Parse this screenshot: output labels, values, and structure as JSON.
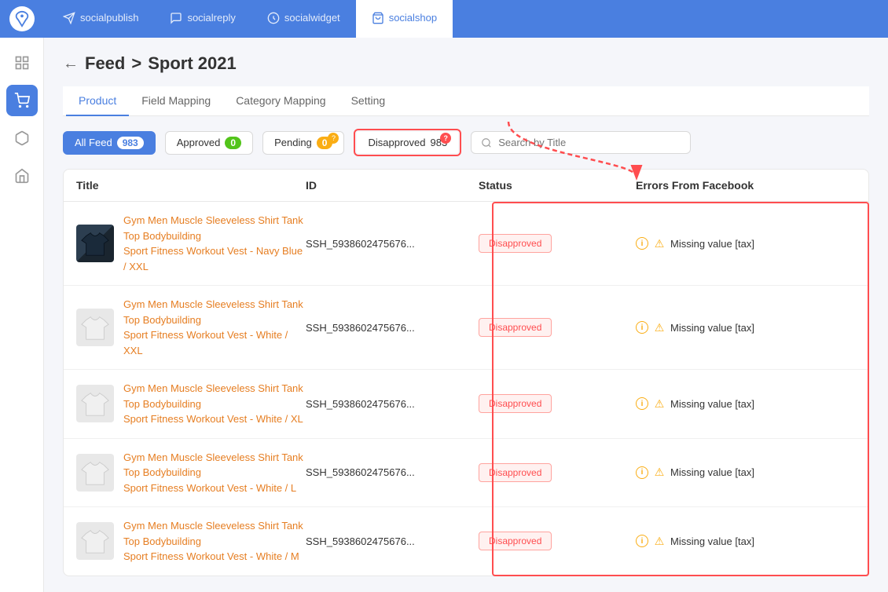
{
  "app": {
    "logo_alt": "Deer logo"
  },
  "nav": {
    "tabs": [
      {
        "id": "socialpublish",
        "label": "socialpublish",
        "active": false
      },
      {
        "id": "socialreply",
        "label": "socialreply",
        "active": false
      },
      {
        "id": "socialwidget",
        "label": "socialwidget",
        "active": false
      },
      {
        "id": "socialshop",
        "label": "socialshop",
        "active": true
      }
    ]
  },
  "sidebar": {
    "items": [
      {
        "id": "dashboard",
        "icon": "grid",
        "active": false
      },
      {
        "id": "socialshop",
        "icon": "shop",
        "active": true
      },
      {
        "id": "box",
        "icon": "box",
        "active": false
      },
      {
        "id": "store",
        "icon": "store",
        "active": false
      }
    ]
  },
  "breadcrumb": {
    "back_label": "Feed",
    "current": "Sport 2021",
    "separator": ">"
  },
  "page_tabs": [
    {
      "id": "product",
      "label": "Product",
      "active": true
    },
    {
      "id": "field-mapping",
      "label": "Field Mapping",
      "active": false
    },
    {
      "id": "category-mapping",
      "label": "Category Mapping",
      "active": false
    },
    {
      "id": "setting",
      "label": "Setting",
      "active": false
    }
  ],
  "filter_buttons": [
    {
      "id": "all-feed",
      "label": "All Feed",
      "count": "983",
      "type": "primary"
    },
    {
      "id": "approved",
      "label": "Approved",
      "count": "0",
      "type": "green"
    },
    {
      "id": "pending",
      "label": "Pending",
      "count": "0",
      "type": "yellow"
    },
    {
      "id": "disapproved",
      "label": "Disapproved",
      "count": "983",
      "type": "red"
    }
  ],
  "search": {
    "placeholder": "Search by Title"
  },
  "table": {
    "headers": [
      {
        "id": "title",
        "label": "Title"
      },
      {
        "id": "id",
        "label": "ID"
      },
      {
        "id": "status",
        "label": "Status"
      },
      {
        "id": "errors",
        "label": "Errors From Facebook"
      }
    ],
    "rows": [
      {
        "id": "SSH_5938602475676",
        "id_display": "SSH_5938602475676...",
        "title_line1": "Gym Men Muscle Sleeveless Shirt Tank Top Bodybuilding",
        "title_line2": "Sport Fitness Workout Vest - Navy Blue / XXL",
        "status": "Disapproved",
        "error": "Missing value [tax]",
        "thumb_color": "navy"
      },
      {
        "id": "SSH_5938602475676",
        "id_display": "SSH_5938602475676...",
        "title_line1": "Gym Men Muscle Sleeveless Shirt Tank Top Bodybuilding",
        "title_line2": "Sport Fitness Workout Vest - White / XXL",
        "status": "Disapproved",
        "error": "Missing value [tax]",
        "thumb_color": "white"
      },
      {
        "id": "SSH_5938602475676",
        "id_display": "SSH_5938602475676...",
        "title_line1": "Gym Men Muscle Sleeveless Shirt Tank Top Bodybuilding",
        "title_line2": "Sport Fitness Workout Vest - White / XL",
        "status": "Disapproved",
        "error": "Missing value [tax]",
        "thumb_color": "white"
      },
      {
        "id": "SSH_5938602475676",
        "id_display": "SSH_5938602475676...",
        "title_line1": "Gym Men Muscle Sleeveless Shirt Tank Top Bodybuilding",
        "title_line2": "Sport Fitness Workout Vest - White / L",
        "status": "Disapproved",
        "error": "Missing value [tax]",
        "thumb_color": "white"
      },
      {
        "id": "SSH_5938602475676",
        "id_display": "SSH_5938602475676...",
        "title_line1": "Gym Men Muscle Sleeveless Shirt Tank Top Bodybuilding",
        "title_line2": "Sport Fitness Workout Vest - White / M",
        "status": "Disapproved",
        "error": "Missing value [tax]",
        "thumb_color": "white"
      }
    ]
  },
  "labels": {
    "disapproved": "Disapproved",
    "missing_value_tax": "Missing value [tax]"
  },
  "colors": {
    "primary": "#4a7fe0",
    "red": "#ff4d4f",
    "green": "#52c41a",
    "yellow": "#faad14",
    "orange_link": "#e67e22"
  }
}
